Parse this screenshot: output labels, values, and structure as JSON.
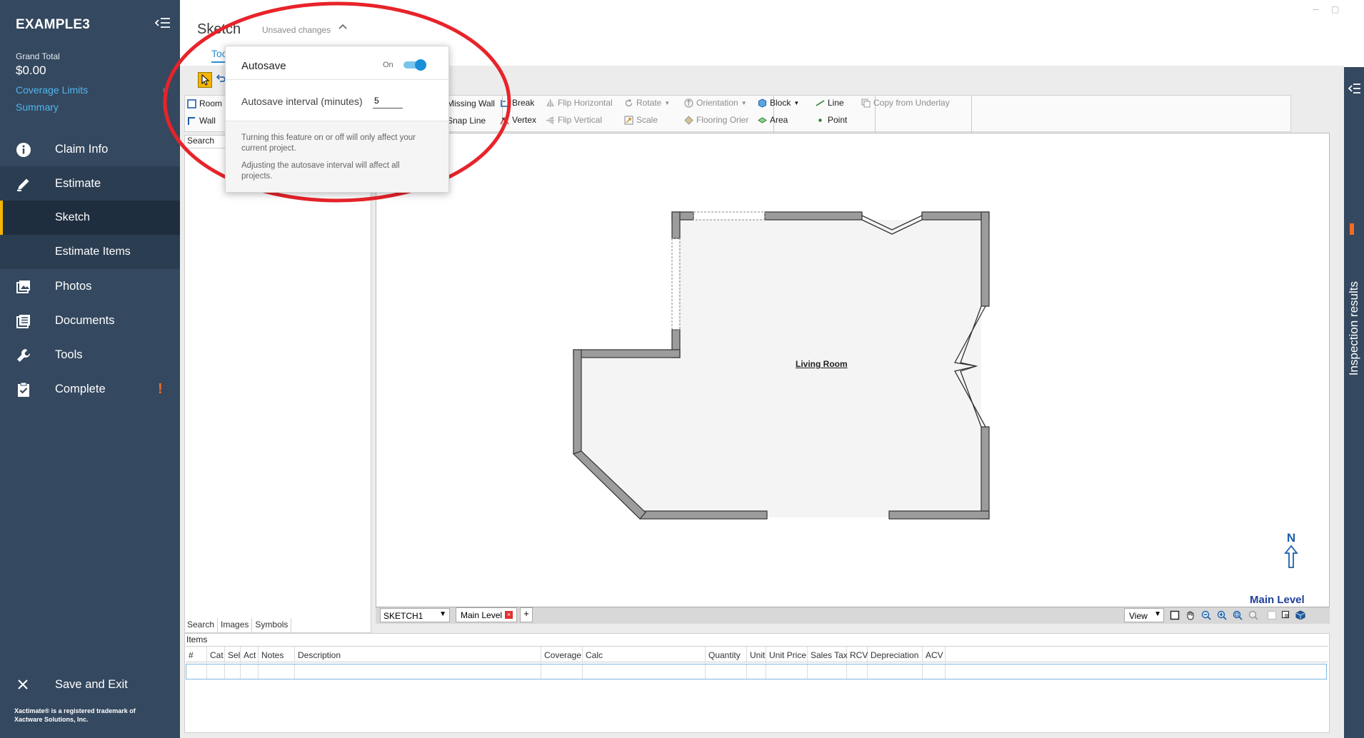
{
  "sidebar": {
    "project_name": "EXAMPLE3",
    "grand_total_label": "Grand Total",
    "grand_total_value": "$0.00",
    "coverage_limits": "Coverage Limits",
    "summary": "Summary",
    "nav": {
      "claim_info": "Claim Info",
      "estimate": "Estimate",
      "sketch": "Sketch",
      "estimate_items": "Estimate Items",
      "photos": "Photos",
      "documents": "Documents",
      "tools": "Tools",
      "complete": "Complete"
    },
    "save_exit": "Save and Exit",
    "trademark_line1": "Xactimate® is a registered trademark of",
    "trademark_line2": "Xactware Solutions, Inc."
  },
  "right_panel": {
    "label": "Inspection results"
  },
  "header": {
    "title": "Sketch",
    "unsaved": "Unsaved changes",
    "tab_tools": "Too"
  },
  "ribbon": {
    "room": "Room",
    "wall": "Wall",
    "missing_wall": "Missing Wall",
    "snap_line": "Snap Line",
    "break": "Break",
    "vertex": "Vertex",
    "flip_horizontal": "Flip Horizontal",
    "flip_vertical": "Flip Vertical",
    "rotate": "Rotate",
    "scale": "Scale",
    "orientation": "Orientation",
    "flooring_orientation": "Flooring Orier",
    "block": "Block",
    "area": "Area",
    "line": "Line",
    "point": "Point",
    "copy_from_underlay": "Copy from Underlay"
  },
  "left_panel": {
    "search_label": "Search",
    "tabs": [
      "Search",
      "Images",
      "Symbols"
    ]
  },
  "canvas": {
    "room_label": "Living Room",
    "north_label": "N",
    "level_name": "Main Level",
    "sketch_select": "SKETCH1",
    "level_tab": "Main Level",
    "add_tab": "+",
    "view_select": "View"
  },
  "items": {
    "label": "Items",
    "columns": [
      "#",
      "Cat",
      "Sel",
      "Act",
      "Notes",
      "Description",
      "Coverage",
      "Calc",
      "Quantity",
      "Unit",
      "Unit Price",
      "Sales Tax",
      "RCV",
      "Depreciation",
      "ACV"
    ]
  },
  "autosave_popup": {
    "title": "Autosave",
    "state": "On",
    "enabled": true,
    "interval_label": "Autosave interval (minutes)",
    "interval_value": "5",
    "note1": "Turning this feature on or off will only affect your current project.",
    "note2": "Adjusting the autosave interval will affect all projects."
  },
  "colors": {
    "sidebar_bg": "#34485f",
    "accent_blue": "#2a8fd2",
    "link_blue": "#4fb5ef",
    "active_marker": "#f4b400",
    "warning": "#f26b21",
    "annotation_red": "#e8232a"
  }
}
